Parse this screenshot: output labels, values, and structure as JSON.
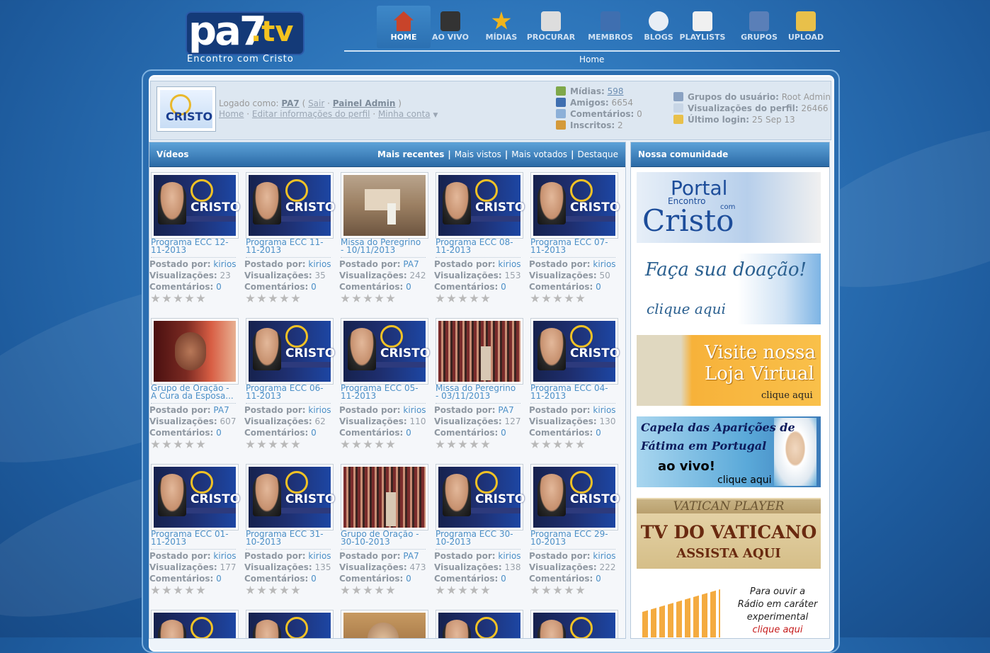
{
  "logo": {
    "main": "pa7",
    "tv": ".tv",
    "tagline": "Encontro com Cristo"
  },
  "nav": {
    "items": [
      {
        "label": "HOME",
        "icon": "home-icon",
        "active": true
      },
      {
        "label": "AO VIVO",
        "icon": "clapperboard-icon"
      },
      {
        "label": "MÍDIAS",
        "icon": "star-icon"
      },
      {
        "label": "PROCURAR",
        "icon": "magnifier-icon"
      },
      {
        "label": "MEMBROS",
        "icon": "member-icon"
      },
      {
        "label": "BLOGS",
        "icon": "speech-bubble-icon"
      },
      {
        "label": "PLAYLISTS",
        "icon": "playlist-icon"
      },
      {
        "label": "GRUPOS",
        "icon": "group-icon"
      },
      {
        "label": "UPLOAD",
        "icon": "upload-box-icon"
      }
    ],
    "sub": "Home"
  },
  "user": {
    "avatar_text": "CRISTO",
    "logged_as_label": "Logado como:",
    "username": "PA7",
    "logout": "Sair",
    "admin": "Painel Admin",
    "links": [
      "Home",
      "Editar informações do perfil",
      "Minha conta"
    ],
    "stats": [
      {
        "label": "Mídias:",
        "value": "598",
        "link": true,
        "icon": "media-icon"
      },
      {
        "label": "Amigos:",
        "value": "6654",
        "icon": "friends-icon"
      },
      {
        "label": "Comentários:",
        "value": "0",
        "icon": "comments-icon"
      },
      {
        "label": "Inscritos:",
        "value": "2",
        "icon": "subscribers-icon"
      }
    ],
    "stats2": [
      {
        "label": "Grupos do usuário:",
        "value": "Root Admin",
        "icon": "groups-icon"
      },
      {
        "label": "Visualizações do perfil:",
        "value": "26466",
        "icon": "views-icon"
      },
      {
        "label": "Último login:",
        "value": "25 Sep 13",
        "icon": "login-icon"
      }
    ]
  },
  "videos": {
    "title": "Vídeos",
    "tabs": [
      "Mais recentes",
      "Mais vistos",
      "Mais votados",
      "Destaque"
    ],
    "labels": {
      "posted_by": "Postado por:",
      "views": "Visualizações:",
      "comments": "Comentários:"
    },
    "items": [
      {
        "title": "Programa ECC 12-11-2013",
        "author": "kirios",
        "views": "23",
        "comments": "0",
        "thumb": "ecc"
      },
      {
        "title": "Programa ECC 11-11-2013",
        "author": "kirios",
        "views": "35",
        "comments": "0",
        "thumb": "ecc"
      },
      {
        "title": "Missa do Peregrino - 10/11/2013",
        "author": "PA7",
        "views": "242",
        "comments": "0",
        "thumb": "church"
      },
      {
        "title": "Programa ECC 08-11-2013",
        "author": "kirios",
        "views": "153",
        "comments": "0",
        "thumb": "ecc"
      },
      {
        "title": "Programa ECC 07-11-2013",
        "author": "kirios",
        "views": "50",
        "comments": "0",
        "thumb": "ecc"
      },
      {
        "title": "Grupo de Oração - A Cura da Esposa...",
        "author": "PA7",
        "views": "607",
        "comments": "0",
        "thumb": "woman"
      },
      {
        "title": "Programa ECC 06-11-2013",
        "author": "kirios",
        "views": "62",
        "comments": "0",
        "thumb": "ecc"
      },
      {
        "title": "Programa ECC 05-11-2013",
        "author": "kirios",
        "views": "110",
        "comments": "0",
        "thumb": "ecc"
      },
      {
        "title": "Missa do Peregrino - 03/11/2013",
        "author": "PA7",
        "views": "127",
        "comments": "0",
        "thumb": "crowd"
      },
      {
        "title": "Programa ECC 04-11-2013",
        "author": "kirios",
        "views": "130",
        "comments": "0",
        "thumb": "ecc"
      },
      {
        "title": "Programa ECC 01-11-2013",
        "author": "kirios",
        "views": "177",
        "comments": "0",
        "thumb": "ecc"
      },
      {
        "title": "Programa ECC 31-10-2013",
        "author": "kirios",
        "views": "135",
        "comments": "0",
        "thumb": "ecc"
      },
      {
        "title": "Grupo de Oração - 30-10-2013",
        "author": "PA7",
        "views": "473",
        "comments": "0",
        "thumb": "crowd"
      },
      {
        "title": "Programa ECC 30-10-2013",
        "author": "kirios",
        "views": "138",
        "comments": "0",
        "thumb": "ecc"
      },
      {
        "title": "Programa ECC 29-10-2013",
        "author": "kirios",
        "views": "222",
        "comments": "0",
        "thumb": "ecc"
      }
    ],
    "partial_row_thumbs": [
      "ecc",
      "ecc",
      "priest",
      "ecc",
      "ecc"
    ]
  },
  "community": {
    "title": "Nossa comunidade",
    "banners": [
      {
        "kind": "portal",
        "lines": [
          "Portal",
          "Encontro",
          "Cristo",
          "com"
        ]
      },
      {
        "kind": "doacao",
        "lines": [
          "Faça sua doação!",
          "clique aqui"
        ]
      },
      {
        "kind": "loja",
        "lines": [
          "Visite nossa",
          "Loja Virtual",
          "clique aqui"
        ]
      },
      {
        "kind": "fatima",
        "lines": [
          "Capela das Aparições de",
          "Fátima em Portugal",
          "ao vivo!",
          "clique aqui"
        ]
      },
      {
        "kind": "vaticano",
        "lines": [
          "VATICAN PLAYER",
          "TV DO VATICANO",
          "ASSISTA AQUI"
        ]
      },
      {
        "kind": "radio",
        "lines": [
          "Para ouvir a",
          "Rádio em caráter",
          "experimental",
          "clique aqui"
        ]
      }
    ]
  }
}
